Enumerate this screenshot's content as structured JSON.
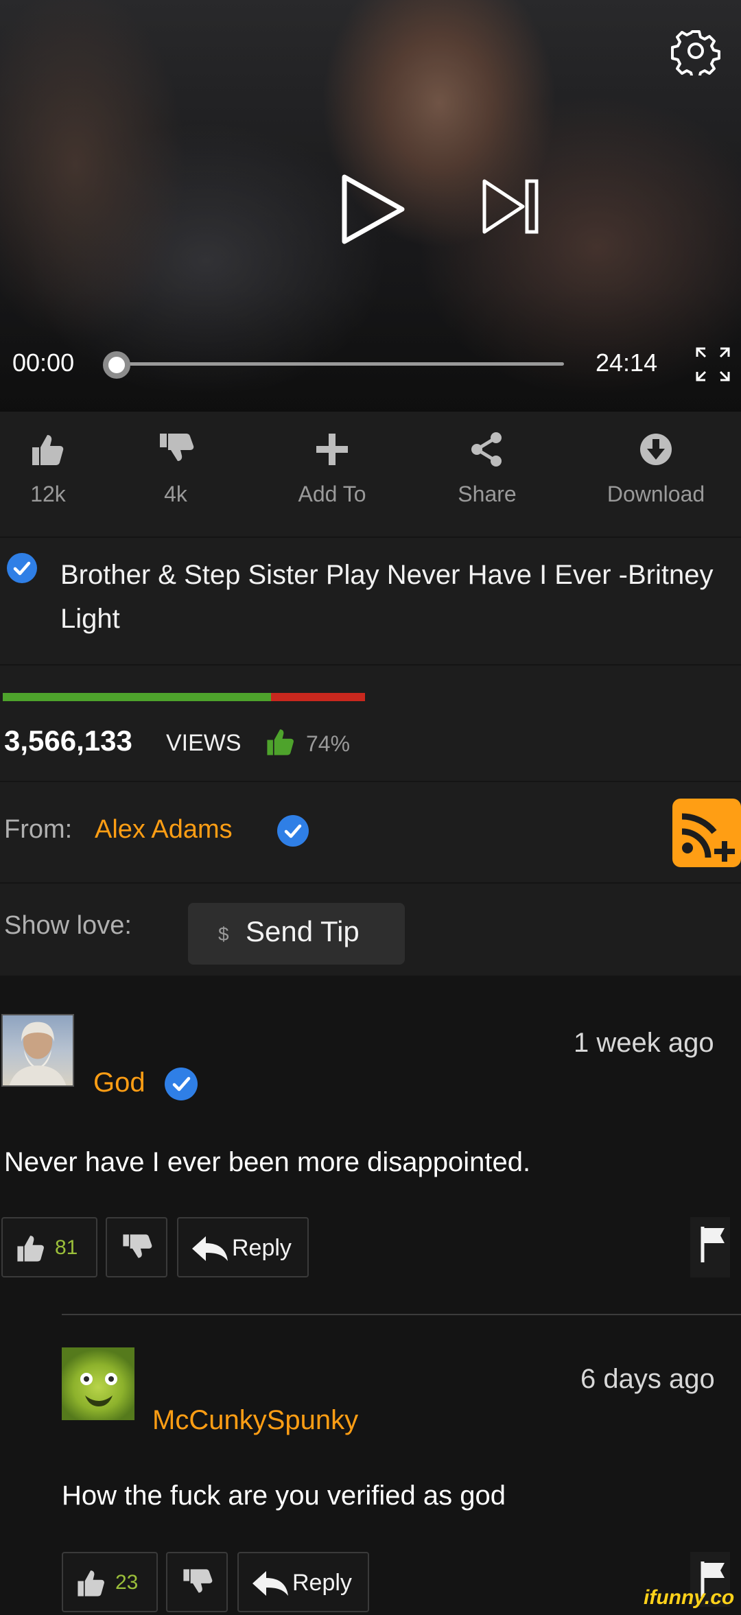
{
  "player": {
    "current_time": "00:00",
    "duration": "24:14",
    "progress": 0.0
  },
  "actions": {
    "like_count": "12k",
    "dislike_count": "4k",
    "add_to": "Add To",
    "share": "Share",
    "download": "Download"
  },
  "video": {
    "title": "Brother & Step Sister Play Never Have I Ever -Britney Light",
    "views": "3,566,133",
    "views_label": "VIEWS",
    "rating": "74%",
    "rating_fraction": 0.74
  },
  "uploader": {
    "from_label": "From:",
    "name": "Alex Adams"
  },
  "tip": {
    "show_love_label": "Show love:",
    "dollar": "$",
    "send_tip": "Send Tip"
  },
  "comments": [
    {
      "author": "God",
      "time": "1 week ago",
      "text": "Never have I ever been more disappointed.",
      "likes": "81",
      "reply_label": "Reply"
    },
    {
      "author": "McCunkySpunky",
      "time": "6 days ago",
      "text": "How the fuck are you verified as god",
      "likes": "23",
      "reply_label": "Reply"
    }
  ],
  "watermark": "ifunny.co",
  "colors": {
    "accent_orange": "#ff9e14",
    "verified_blue": "#2f7fe6",
    "rating_green": "#4ea32c",
    "rating_red": "#c9281e"
  },
  "icons": [
    "gear-icon",
    "play-icon",
    "skip-next-icon",
    "fullscreen-icon",
    "thumbs-up-icon",
    "thumbs-down-icon",
    "plus-icon",
    "share-icon",
    "download-icon",
    "verified-icon",
    "rss-subscribe-icon",
    "reply-icon",
    "flag-icon"
  ]
}
